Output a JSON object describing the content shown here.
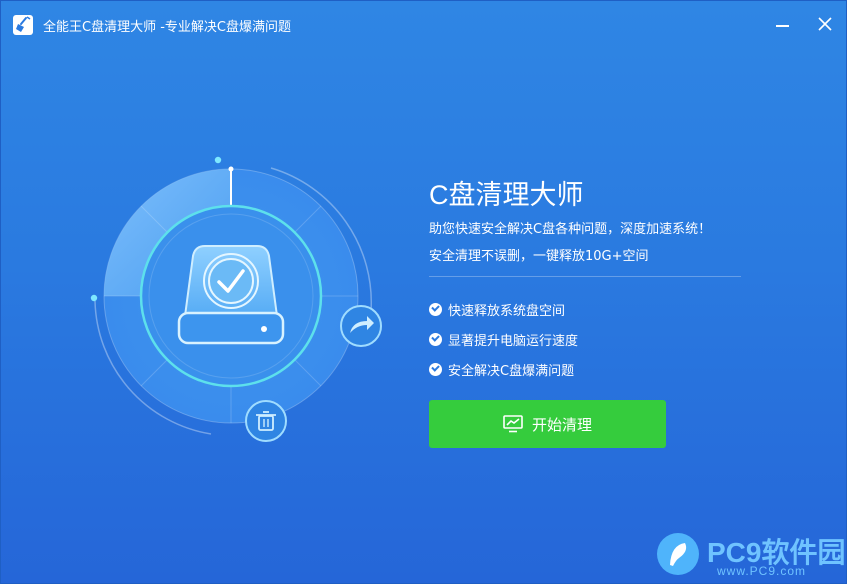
{
  "window": {
    "title": "全能王C盘清理大师  -专业解决C盘爆满问题"
  },
  "hero": {
    "headline": "C盘清理大师",
    "description_1": "助您快速安全解决C盘各种问题，深度加速系统！",
    "description_2": "安全清理不误删，一键释放10G+空间"
  },
  "features": [
    {
      "label": "快速释放系统盘空间"
    },
    {
      "label": "显著提升电脑运行速度"
    },
    {
      "label": "安全解决C盘爆满问题"
    }
  ],
  "start_button": {
    "label": "开始清理",
    "icon": "monitor-chart-icon"
  },
  "watermark": {
    "title": "PC9软件园",
    "url": "www.PC9.com"
  },
  "colors": {
    "background": "#2a7ae0",
    "button_green": "#35cc3d",
    "watermark_blue": "#6fc3ff"
  }
}
